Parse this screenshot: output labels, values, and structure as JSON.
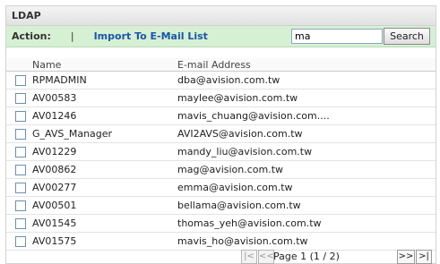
{
  "title": "LDAP",
  "action": {
    "label": "Action:",
    "separator": "|",
    "import_link": "Import To E-Mail List",
    "search_value": "ma",
    "search_button": "Search"
  },
  "table": {
    "headers": {
      "name": "Name",
      "email": "E-mail Address"
    },
    "rows": [
      {
        "name": "RPMADMIN",
        "email": "dba@avision.com.tw"
      },
      {
        "name": "AV00583",
        "email": "maylee@avision.com.tw"
      },
      {
        "name": "AV01246",
        "email": "mavis_chuang@avision.com...."
      },
      {
        "name": "G_AVS_Manager",
        "email": "AVI2AVS@avision.com.tw"
      },
      {
        "name": "AV01229",
        "email": "mandy_liu@avision.com.tw"
      },
      {
        "name": "AV00862",
        "email": "mag@avision.com.tw"
      },
      {
        "name": "AV00277",
        "email": "emma@avision.com.tw"
      },
      {
        "name": "AV00501",
        "email": "bellama@avision.com.tw"
      },
      {
        "name": "AV01545",
        "email": "thomas_yeh@avision.com.tw"
      },
      {
        "name": "AV01575",
        "email": "mavis_ho@avision.com.tw"
      }
    ]
  },
  "pager": {
    "first": "|<",
    "prev": "<<",
    "page_text": "Page 1 (1 / 2)",
    "next": ">>",
    "last": ">|"
  }
}
